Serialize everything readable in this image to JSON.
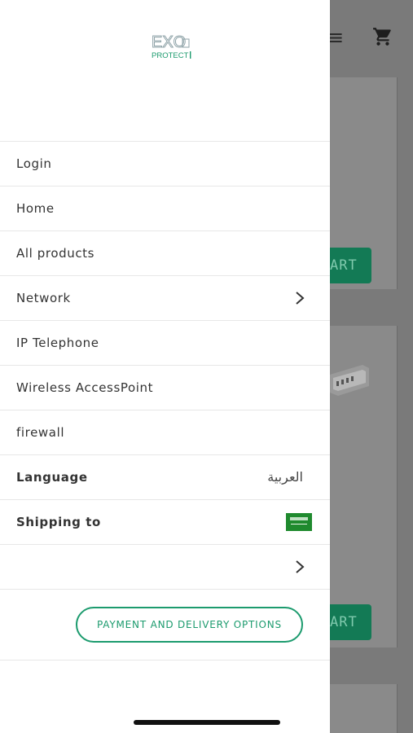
{
  "brand": {
    "logo_text_top": "EXO",
    "logo_text_bottom": "PROTECT"
  },
  "menu": {
    "items": [
      {
        "label": "Login"
      },
      {
        "label": "Home"
      },
      {
        "label": "All products"
      },
      {
        "label": "Network",
        "has_submenu": true
      },
      {
        "label": "IP Telephone"
      },
      {
        "label": "Wireless AccessPoint"
      },
      {
        "label": "firewall"
      }
    ],
    "language": {
      "label": "Language",
      "value": "العربية"
    },
    "shipping": {
      "label": "Shipping to",
      "country_flag": "saudi-arabia-flag"
    },
    "empty_row": {
      "label": "",
      "has_submenu": true
    },
    "payment_button": "PAYMENT AND DELIVERY OPTIONS"
  },
  "background": {
    "cart_button_label": "ART"
  },
  "colors": {
    "accent": "#1c9b6e",
    "overlay": "#7a7a7a",
    "cart_button": "#137a55"
  }
}
